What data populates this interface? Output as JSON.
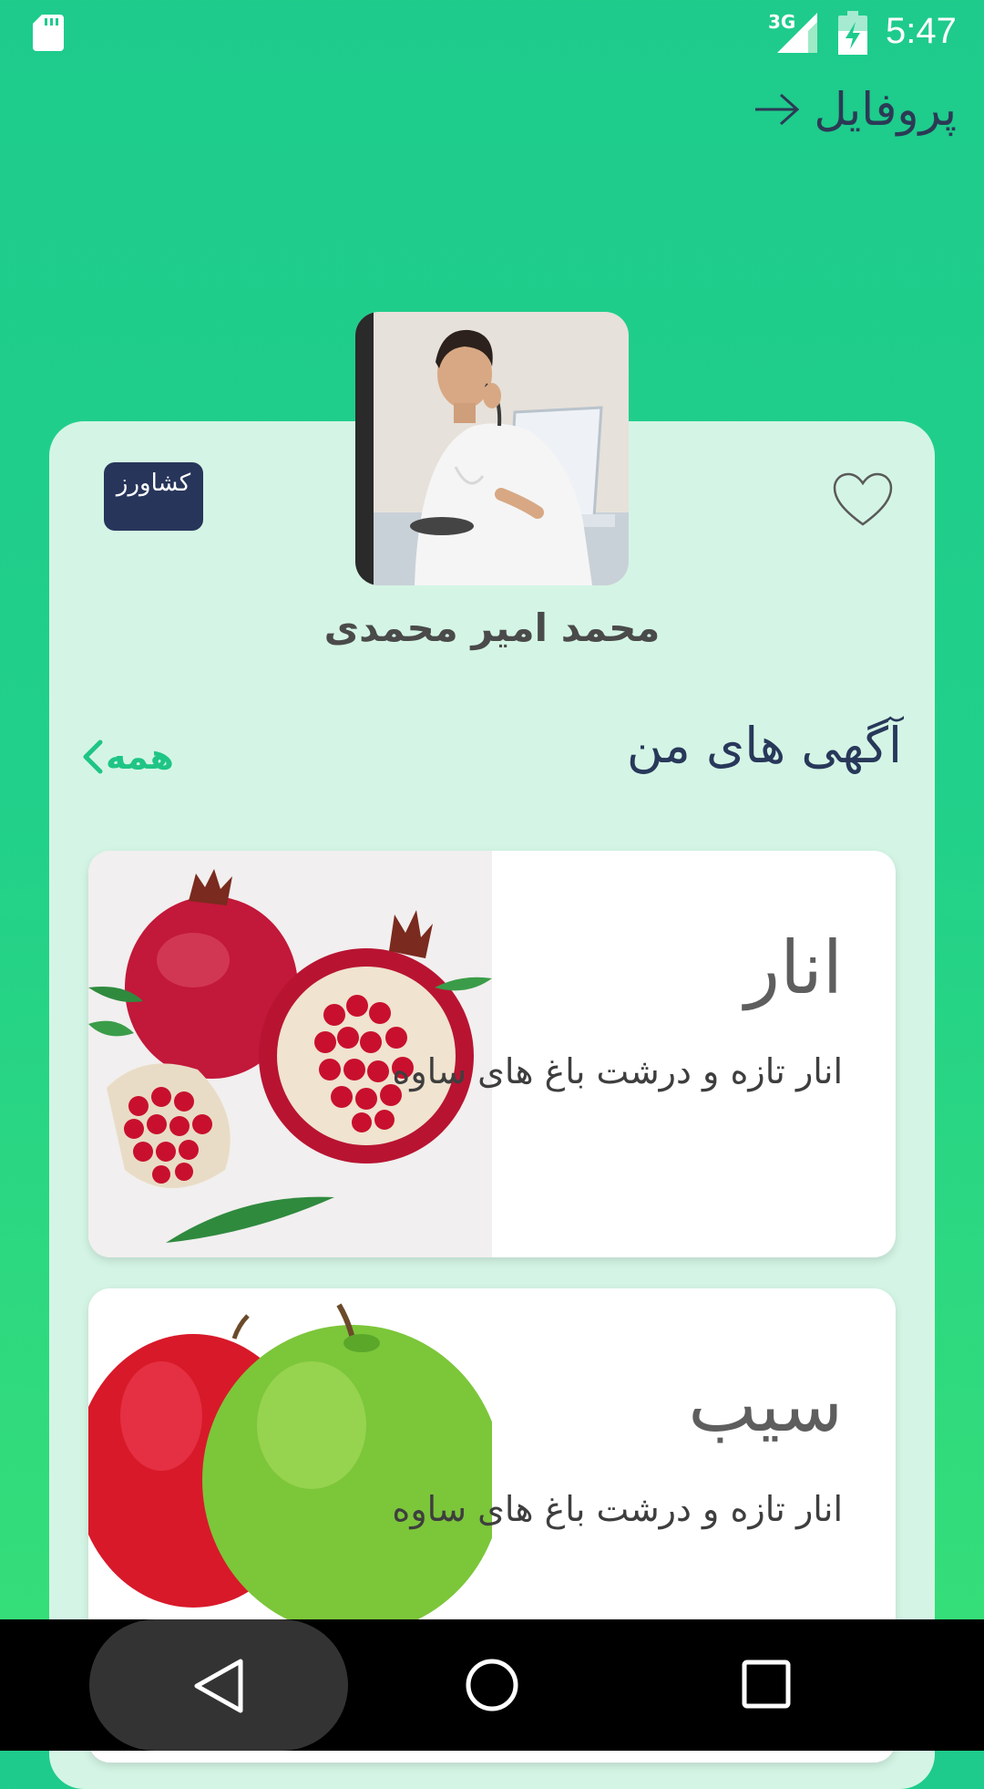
{
  "status_bar": {
    "time": "5:47",
    "network_label": "3G",
    "icons": [
      "sd-card-icon",
      "cell-signal-icon",
      "battery-charging-icon"
    ]
  },
  "header": {
    "title": "پروفایل",
    "back_icon": "arrow-right-icon"
  },
  "profile": {
    "name": "محمد امیر محمدی",
    "role_badge": "کشاورز",
    "favorite_icon": "heart-outline-icon"
  },
  "ads_section": {
    "title": "آگهی های من",
    "see_all_label": "همه",
    "see_all_icon": "chevron-left-icon",
    "items": [
      {
        "title": "انار",
        "description": "انار تازه و درشت باغ های ساوه",
        "image": "pomegranate-image"
      },
      {
        "title": "سیب",
        "description": "انار تازه و درشت باغ های ساوه",
        "image": "apple-image"
      }
    ]
  },
  "nav_bar": {
    "icons": [
      "nav-back-icon",
      "nav-home-icon",
      "nav-recents-icon"
    ]
  },
  "colors": {
    "accent_green": "#1fc585",
    "navy": "#27355a",
    "card_bg": "#d4f5e5"
  }
}
